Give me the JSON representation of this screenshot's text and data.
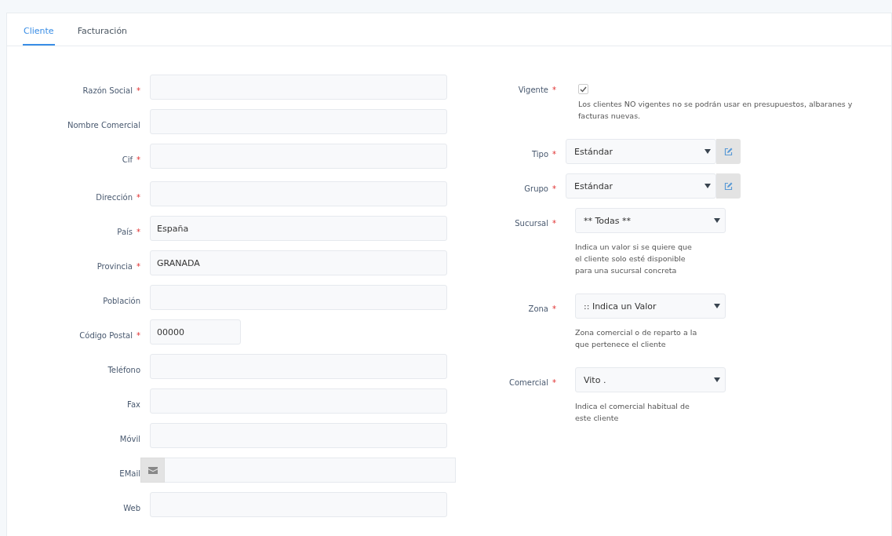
{
  "tabs": [
    {
      "label": "Cliente",
      "selected": true
    },
    {
      "label": "Facturación",
      "selected": false
    }
  ],
  "left_fields": [
    {
      "kind": "text",
      "label": "Razón Social",
      "required_mark": "*"
    },
    {
      "kind": "text",
      "label": "Nombre Comercial"
    },
    {
      "kind": "text",
      "label": "Cif",
      "required_mark": "*"
    },
    {
      "kind": "text",
      "label": "Dirección",
      "required_mark": "*"
    },
    {
      "kind": "text",
      "label": "País",
      "required_mark": "*",
      "value": "España"
    },
    {
      "kind": "text",
      "label": "Provincia",
      "required_mark": "*",
      "value": "GRANADA"
    },
    {
      "kind": "text",
      "label": "Población"
    },
    {
      "kind": "short",
      "label": "Código Postal",
      "required_mark": "*",
      "value": "00000"
    },
    {
      "kind": "text",
      "label": "Teléfono"
    },
    {
      "kind": "text",
      "label": "Fax"
    },
    {
      "kind": "text",
      "label": "Móvil"
    },
    {
      "kind": "email",
      "label": "EMail"
    },
    {
      "kind": "text",
      "label": "Web"
    }
  ],
  "right_fields": [
    {
      "kind": "checkbox",
      "label": "Vigente",
      "required_mark": "*",
      "checked": true,
      "help": "Los clientes NO vigentes no se podrán usar en presupuestos, albaranes y facturas nuevas."
    },
    {
      "kind": "select_edit",
      "label": "Tipo",
      "required_mark": "*",
      "value": "Estándar"
    },
    {
      "kind": "select_edit",
      "label": "Grupo",
      "required_mark": "*",
      "value": "Estándar"
    },
    {
      "kind": "select",
      "label": "Sucursal",
      "required_mark": "*",
      "value": "** Todas **",
      "help": "Indica un valor si se quiere que el cliente solo esté disponible para una sucursal concreta"
    },
    {
      "kind": "select",
      "label": "Zona",
      "required_mark": "*",
      "value": ":: Indica un Valor",
      "help": "Zona comercial o de reparto a la que pertenece el cliente"
    },
    {
      "kind": "select",
      "label": "Comercial",
      "required_mark": "*",
      "value": "Vito .",
      "help": "Indica el comercial habitual de este cliente"
    }
  ]
}
